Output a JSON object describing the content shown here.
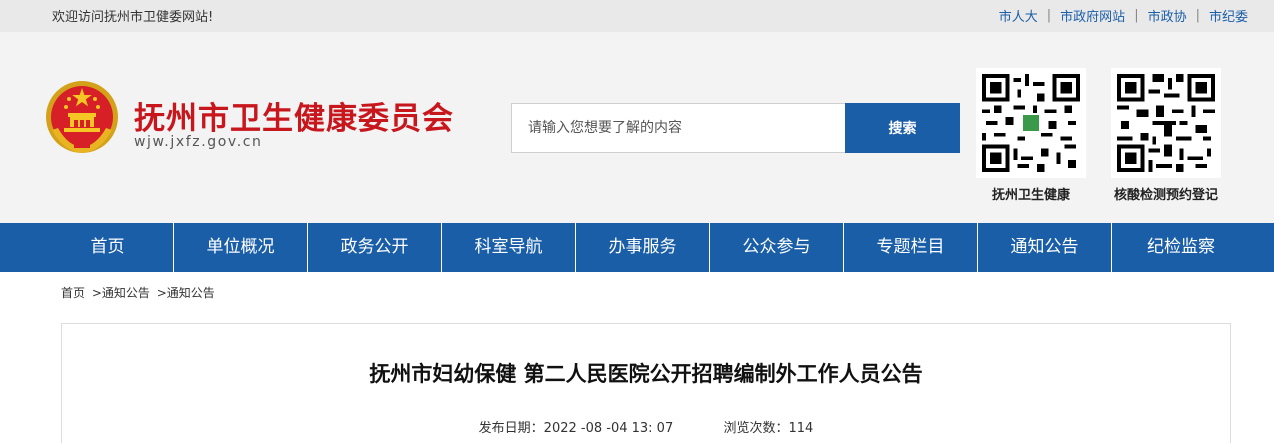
{
  "topbar": {
    "welcome": "欢迎访问抚州市卫健委网站!",
    "links": [
      "市人大",
      "市政府网站",
      "市政协",
      "市纪委"
    ],
    "separator": "|"
  },
  "header": {
    "title": "抚州市卫生健康委员会",
    "domain": "wjw.jxfz.gov.cn",
    "search_placeholder": "请输入您想要了解的内容",
    "search_button": "搜索",
    "qr_codes": [
      {
        "label": "抚州卫生健康",
        "icon": "qr-code-icon"
      },
      {
        "label": "核酸检测预约登记",
        "icon": "qr-code-icon"
      }
    ],
    "emblem_icon": "national-emblem-icon"
  },
  "nav": [
    "首页",
    "单位概况",
    "政务公开",
    "科室导航",
    "办事服务",
    "公众参与",
    "专题栏目",
    "通知公告",
    "纪检监察"
  ],
  "breadcrumb": [
    "首页",
    ">通知公告",
    ">通知公告"
  ],
  "article": {
    "title": "抚州市妇幼保健 第二人民医院公开招聘编制外工作人员公告",
    "date_label": "发布日期：",
    "date": "2022 -08 -04 13: 07",
    "views_label": "浏览次数：",
    "views": "114"
  },
  "colors": {
    "brand_blue": "#1a5ea8",
    "title_red": "#c8161d",
    "topbar_bg": "#e9e9e9",
    "header_bg": "#f3f3f3"
  }
}
